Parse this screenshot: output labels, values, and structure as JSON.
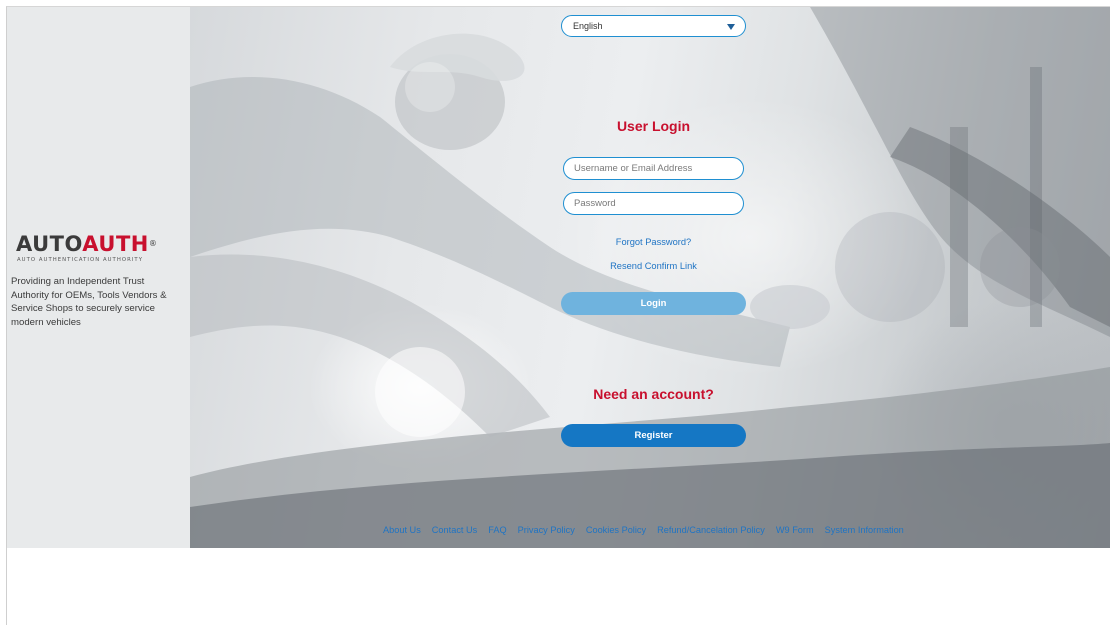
{
  "brand": {
    "logo_text_a": "AUTO",
    "logo_text_b": "AUTH",
    "logo_reg": "®",
    "logo_subtitle": "AUTO AUTHENTICATION AUTHORITY",
    "tagline": "Providing an Independent Trust Authority for OEMs, Tools Vendors & Service Shops to securely service modern vehicles",
    "accent_color": "#c8102e"
  },
  "language": {
    "selected": "English"
  },
  "login": {
    "title": "User Login",
    "username_placeholder": "Username or Email Address",
    "password_placeholder": "Password",
    "forgot_password": "Forgot Password?",
    "resend_confirm": "Resend Confirm Link",
    "login_button": "Login"
  },
  "register": {
    "heading": "Need an account?",
    "register_button": "Register"
  },
  "footer": {
    "links": [
      "About Us",
      "Contact Us",
      "FAQ",
      "Privacy Policy",
      "Cookies Policy",
      "Refund/Cancelation Policy",
      "W9 Form",
      "System Information"
    ]
  }
}
